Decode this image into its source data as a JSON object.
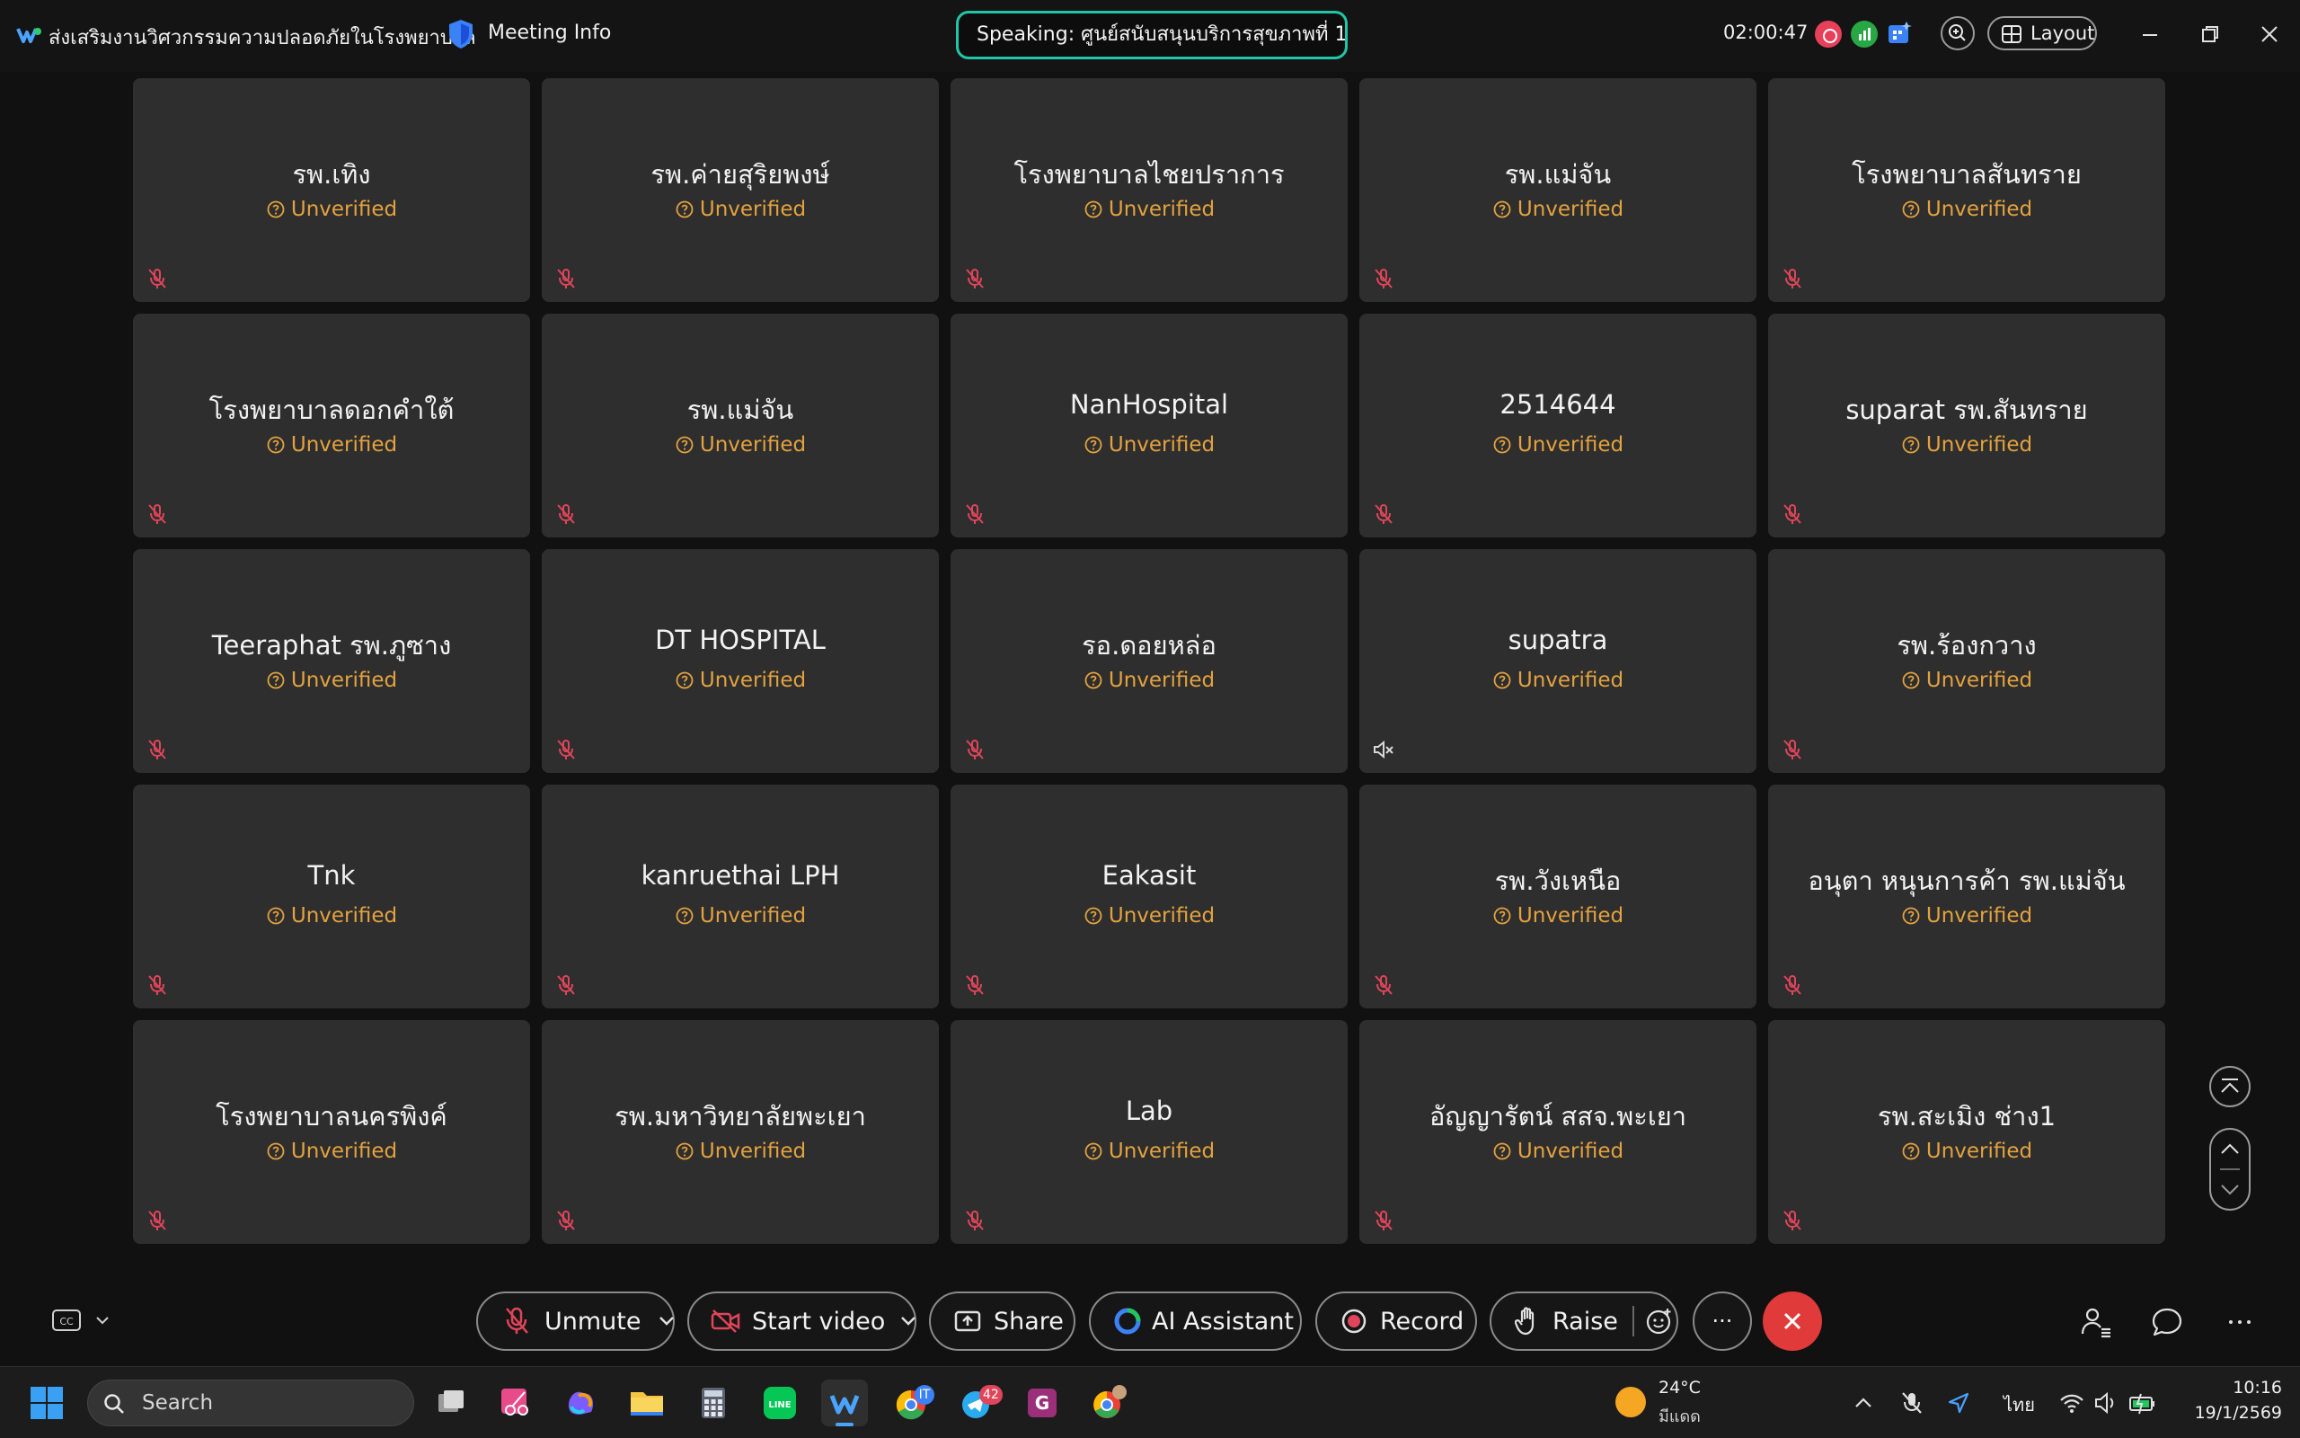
{
  "titlebar": {
    "meeting_title": "ส่งเสริมงานวิศวกรรมความปลอดภัยในโรงพยาบาล",
    "meeting_info": "Meeting Info",
    "speaking": "Speaking: ศูนย์สนับสนุนบริการสุขภาพที่ 1",
    "timer": "02:00:47",
    "layout_label": "Layout"
  },
  "participants": [
    {
      "name": "รพ.เทิง",
      "status": "Unverified",
      "audio": "muted"
    },
    {
      "name": "รพ.ค่ายสุริยพงษ์",
      "status": "Unverified",
      "audio": "muted"
    },
    {
      "name": "โรงพยาบาลไชยปราการ",
      "status": "Unverified",
      "audio": "muted"
    },
    {
      "name": "รพ.แม่จัน",
      "status": "Unverified",
      "audio": "muted"
    },
    {
      "name": "โรงพยาบาลสันทราย",
      "status": "Unverified",
      "audio": "muted"
    },
    {
      "name": "โรงพยาบาลดอกคำใต้",
      "status": "Unverified",
      "audio": "muted"
    },
    {
      "name": "รพ.แม่จัน",
      "status": "Unverified",
      "audio": "muted"
    },
    {
      "name": "NanHospital",
      "status": "Unverified",
      "audio": "muted"
    },
    {
      "name": "2514644",
      "status": "Unverified",
      "audio": "muted"
    },
    {
      "name": "suparat รพ.สันทราย",
      "status": "Unverified",
      "audio": "muted"
    },
    {
      "name": "Teeraphat รพ.ภูซาง",
      "status": "Unverified",
      "audio": "muted"
    },
    {
      "name": "DT HOSPITAL",
      "status": "Unverified",
      "audio": "muted"
    },
    {
      "name": "รอ.ดอยหล่อ",
      "status": "Unverified",
      "audio": "muted"
    },
    {
      "name": "supatra",
      "status": "Unverified",
      "audio": "speaker-off"
    },
    {
      "name": "รพ.ร้องกวาง",
      "status": "Unverified",
      "audio": "muted"
    },
    {
      "name": "Tnk",
      "status": "Unverified",
      "audio": "muted"
    },
    {
      "name": "kanruethai LPH",
      "status": "Unverified",
      "audio": "muted"
    },
    {
      "name": "Eakasit",
      "status": "Unverified",
      "audio": "muted"
    },
    {
      "name": "รพ.วังเหนือ",
      "status": "Unverified",
      "audio": "muted"
    },
    {
      "name": "อนุตา หนุนการค้า รพ.แม่จัน",
      "status": "Unverified",
      "audio": "muted"
    },
    {
      "name": "โรงพยาบาลนครพิงค์",
      "status": "Unverified",
      "audio": "muted"
    },
    {
      "name": "รพ.มหาวิทยาลัยพะเยา",
      "status": "Unverified",
      "audio": "muted"
    },
    {
      "name": "Lab",
      "status": "Unverified",
      "audio": "muted"
    },
    {
      "name": "อัญญารัตน์ สสจ.พะเยา",
      "status": "Unverified",
      "audio": "muted"
    },
    {
      "name": "รพ.สะเมิง ช่าง1",
      "status": "Unverified",
      "audio": "muted"
    }
  ],
  "controls": {
    "unmute": "Unmute",
    "start_video": "Start video",
    "share": "Share",
    "ai_assistant": "AI Assistant",
    "record": "Record",
    "raise": "Raise",
    "more": "···"
  },
  "taskbar": {
    "search_label": "Search",
    "chrome_badge": "IT",
    "telegram_badge": "42",
    "weather_temp": "24°C",
    "weather_cond": "มีแดด",
    "language": "ไทย",
    "time": "10:16",
    "date": "19/1/2569"
  },
  "colors": {
    "accent_teal": "#1fc7a8",
    "unverified_amber": "#e3a23f",
    "muted_red": "#e0455a",
    "end_call_red": "#e03a3a",
    "tile_bg": "#2e2e2e"
  }
}
